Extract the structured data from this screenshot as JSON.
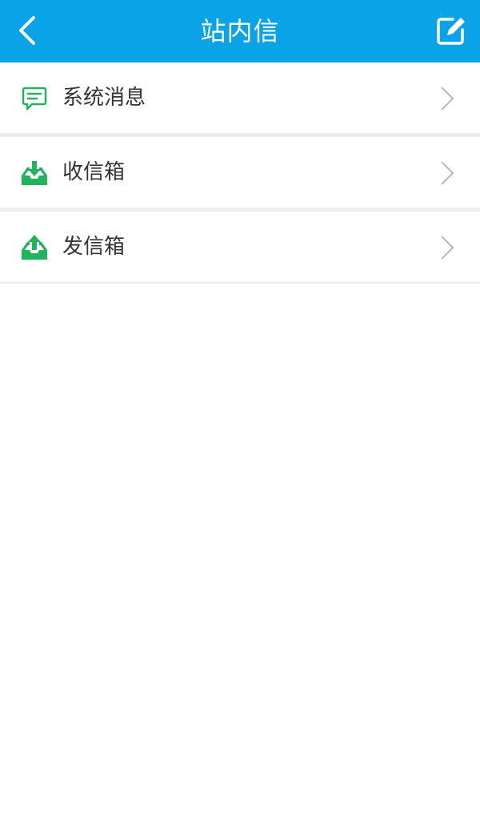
{
  "header": {
    "title": "站内信",
    "back_icon": "chevron-left-icon",
    "edit_icon": "edit-icon",
    "background": "#0aa3e8"
  },
  "menu": {
    "items": [
      {
        "label": "系统消息",
        "icon": "message-icon"
      },
      {
        "label": "收信箱",
        "icon": "inbox-icon"
      },
      {
        "label": "发信箱",
        "icon": "outbox-icon"
      }
    ],
    "icon_color": "#22b35e"
  }
}
